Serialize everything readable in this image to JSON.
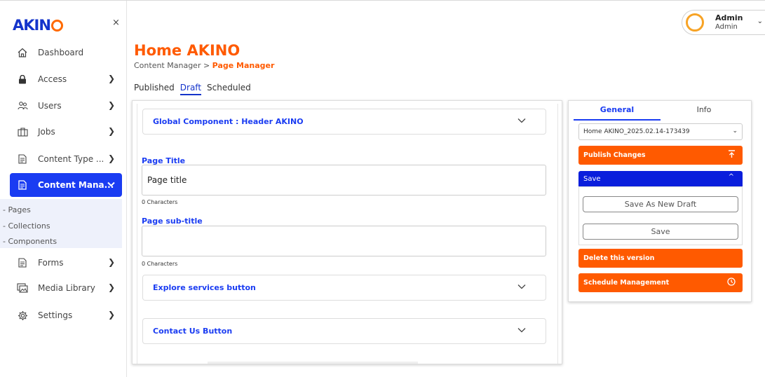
{
  "sidebar": {
    "logo": "AKIN",
    "close_symbol": "×",
    "items": [
      {
        "label": "Dashboard",
        "icon": "home-icon"
      },
      {
        "label": "Access",
        "icon": "lock-icon"
      },
      {
        "label": "Users",
        "icon": "users-icon"
      },
      {
        "label": "Jobs",
        "icon": "briefcase-icon"
      },
      {
        "label": "Content Type ...",
        "icon": "document-icon"
      },
      {
        "label": "Content Mana...",
        "icon": "document-icon"
      },
      {
        "label": "Forms",
        "icon": "document-icon"
      },
      {
        "label": "Media Library",
        "icon": "media-icon"
      },
      {
        "label": "Settings",
        "icon": "gear-icon"
      }
    ],
    "sub_items": [
      "- Pages",
      "- Collections",
      "- Components"
    ]
  },
  "user": {
    "name": "Admin",
    "role": "Admin"
  },
  "page": {
    "title": "Home AKINO",
    "breadcrumb_parent": "Content Manager > ",
    "breadcrumb_current": "Page Manager",
    "tabs": [
      "Published",
      "Draft",
      "Scheduled"
    ],
    "active_tab": "Draft"
  },
  "editor": {
    "global_component": "Global Component : Header AKINO",
    "page_title_label": "Page Title",
    "page_title_value": "Page title",
    "page_title_count": "0 Characters",
    "page_subtitle_label": "Page sub-title",
    "page_subtitle_value": "",
    "page_subtitle_count": "0 Characters",
    "explore_button": "Explore services button",
    "contact_button": "Contact Us Button"
  },
  "right_panel": {
    "tabs": [
      "General",
      "Info"
    ],
    "version": "Home AKINO_2025.02.14-173439",
    "publish": "Publish Changes",
    "save_header": "Save",
    "save_as_new": "Save As New Draft",
    "save": "Save",
    "delete": "Delete this version",
    "schedule": "Schedule Management"
  },
  "colors": {
    "accent_blue": "#1a3cf2",
    "accent_orange": "#ff5a00"
  }
}
